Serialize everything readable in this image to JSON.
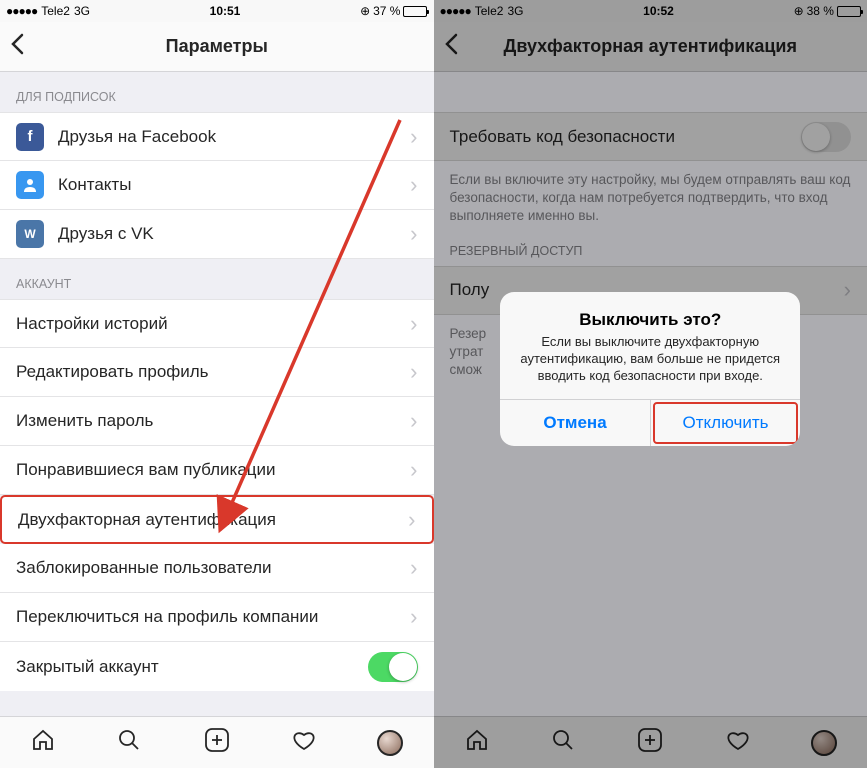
{
  "left": {
    "statusbar": {
      "carrier": "Tele2",
      "network": "3G",
      "time": "10:51",
      "battery_pct": "37 %",
      "battery_fill": 37
    },
    "nav_title": "Параметры",
    "section1": "ДЛЯ ПОДПИСОК",
    "rows1": [
      {
        "label": "Друзья на Facebook",
        "icon": "f",
        "icon_bg": "#3b5998"
      },
      {
        "label": "Контакты",
        "icon": "",
        "icon_bg": "#3897f0"
      },
      {
        "label": "Друзья с VK",
        "icon": "w",
        "icon_bg": "#4a76a8"
      }
    ],
    "section2": "АККАУНТ",
    "rows2": [
      {
        "label": "Настройки историй"
      },
      {
        "label": "Редактировать профиль"
      },
      {
        "label": "Изменить пароль"
      },
      {
        "label": "Понравившиеся вам публикации"
      },
      {
        "label": "Двухфакторная аутентификация",
        "highlight": true
      },
      {
        "label": "Заблокированные пользователи"
      },
      {
        "label": "Переключиться на профиль компании"
      },
      {
        "label": "Закрытый аккаунт",
        "toggle": true
      }
    ]
  },
  "right": {
    "statusbar": {
      "carrier": "Tele2",
      "network": "3G",
      "time": "10:52",
      "battery_pct": "38 %",
      "battery_fill": 38
    },
    "nav_title": "Двухфакторная аутентификация",
    "row1_label": "Требовать код безопасности",
    "desc1": "Если вы включите эту настройку, мы будем отправлять ваш код безопасности, когда нам потребуется подтвердить, что вход выполняете именно вы.",
    "section": "РЕЗЕРВНЫЙ ДОСТУП",
    "row2_label": "Полу",
    "desc2_a": "Резер",
    "desc2_b": "утрат",
    "desc2_c": "смож",
    "dialog": {
      "title": "Выключить это?",
      "text": "Если вы выключите двухфакторную аутентификацию, вам больше не придется вводить код безопасности при входе.",
      "cancel": "Отмена",
      "confirm": "Отключить"
    }
  }
}
